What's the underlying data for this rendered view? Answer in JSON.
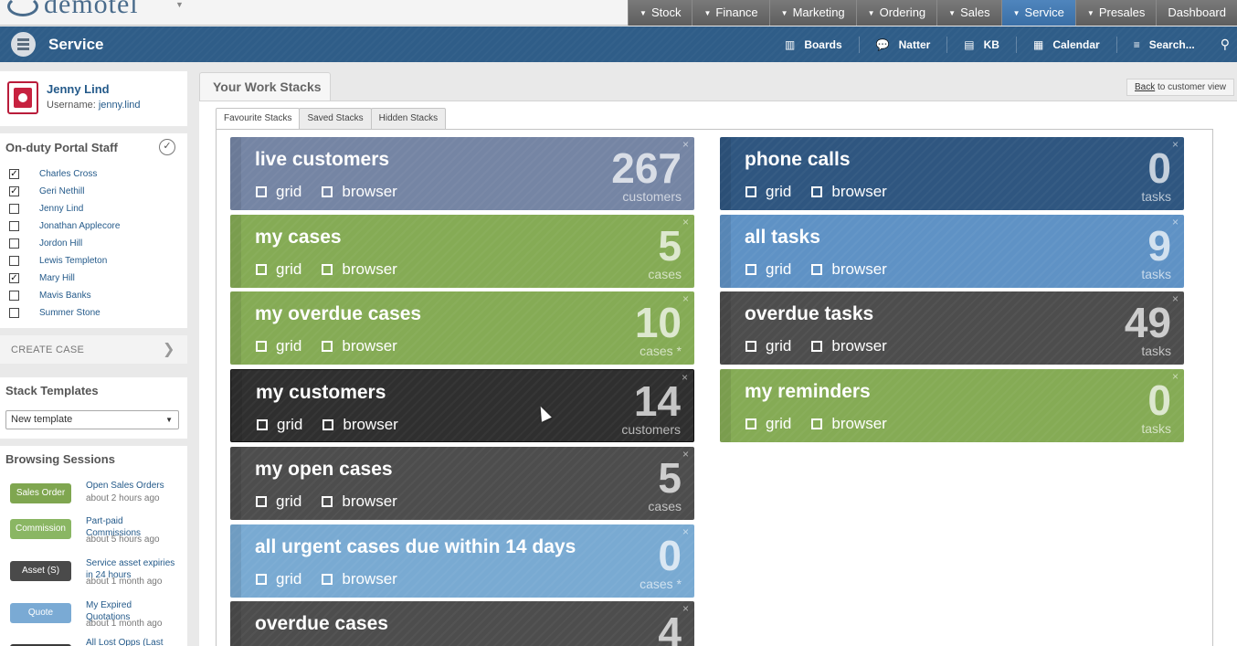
{
  "app": {
    "logo_text": "demotel"
  },
  "topnav": {
    "items": [
      {
        "label": "Stock",
        "active": false,
        "caret": true
      },
      {
        "label": "Finance",
        "active": false,
        "caret": true
      },
      {
        "label": "Marketing",
        "active": false,
        "caret": true
      },
      {
        "label": "Ordering",
        "active": false,
        "caret": true
      },
      {
        "label": "Sales",
        "active": false,
        "caret": true
      },
      {
        "label": "Service",
        "active": true,
        "caret": true
      },
      {
        "label": "Presales",
        "active": false,
        "caret": true
      },
      {
        "label": "Dashboard",
        "active": false,
        "caret": false
      }
    ]
  },
  "servicebar": {
    "title": "Service",
    "items": [
      {
        "label": "Boards",
        "icon": "boards-icon"
      },
      {
        "label": "Natter",
        "icon": "chat-icon"
      },
      {
        "label": "KB",
        "icon": "document-icon"
      },
      {
        "label": "Calendar",
        "icon": "calendar-icon"
      },
      {
        "label": "Search...",
        "icon": "menu-icon"
      }
    ]
  },
  "user": {
    "name": "Jenny Lind",
    "username_label": "Username:",
    "username": "jenny.lind"
  },
  "staff": {
    "heading": "On-duty Portal Staff",
    "members": [
      {
        "name": "Charles Cross",
        "checked": true
      },
      {
        "name": "Geri Nethill",
        "checked": true
      },
      {
        "name": "Jenny Lind",
        "checked": false
      },
      {
        "name": "Jonathan Applecore",
        "checked": false
      },
      {
        "name": "Jordon Hill",
        "checked": false
      },
      {
        "name": "Lewis Templeton",
        "checked": false
      },
      {
        "name": "Mary Hill",
        "checked": true
      },
      {
        "name": "Mavis Banks",
        "checked": false
      },
      {
        "name": "Summer Stone",
        "checked": false
      }
    ]
  },
  "create_case": {
    "label": "CREATE CASE"
  },
  "stack_templates": {
    "heading": "Stack Templates",
    "selected": "New template"
  },
  "browsing_sessions": {
    "heading": "Browsing Sessions",
    "sessions": [
      {
        "badge": "Sales Order",
        "badge_color": "#7fa650",
        "title": "Open Sales Orders",
        "time": "about 2 hours ago"
      },
      {
        "badge": "Commission",
        "badge_color": "#8ab663",
        "title": "Part-paid Commissions",
        "time": "about 5 hours ago"
      },
      {
        "badge": "Asset (S)",
        "badge_color": "#4a4a4a",
        "title": "Service asset expiries in 24 hours",
        "time": "about 1 month ago"
      },
      {
        "badge": "Quote",
        "badge_color": "#7aaad4",
        "title": "My Expired Quotations",
        "time": "about 1 month ago"
      },
      {
        "badge": "",
        "badge_color": "#3a3a3a",
        "title": "All Lost Opps (Last",
        "time": ""
      }
    ]
  },
  "main": {
    "title": "Your Work Stacks",
    "back_link": "Back",
    "back_text": "to customer view",
    "tabs": [
      {
        "label": "Favourite Stacks",
        "active": true
      },
      {
        "label": "Saved Stacks",
        "active": false
      },
      {
        "label": "Hidden Stacks",
        "active": false
      }
    ],
    "option_grid": "grid",
    "option_browser": "browser",
    "close_glyph": "×"
  },
  "stacks_left": [
    {
      "title": "live customers",
      "count": "267",
      "unit": "customers",
      "color": "#7585a4"
    },
    {
      "title": "my cases",
      "count": "5",
      "unit": "cases",
      "color": "#85ab55"
    },
    {
      "title": "my overdue cases",
      "count": "10",
      "unit": "cases *",
      "color": "#85ab55"
    },
    {
      "title": "my customers",
      "count": "14",
      "unit": "customers",
      "color": "#2f2f2f"
    },
    {
      "title": "my open cases",
      "count": "5",
      "unit": "cases",
      "color": "#4d4d4d"
    },
    {
      "title": "all urgent cases due within 14 days",
      "count": "0",
      "unit": "cases *",
      "color": "#79aad2"
    },
    {
      "title": "overdue cases",
      "count": "4",
      "unit": "",
      "color": "#4d4d4d"
    }
  ],
  "stacks_right": [
    {
      "title": "phone calls",
      "count": "0",
      "unit": "tasks",
      "color": "#2f5680"
    },
    {
      "title": "all tasks",
      "count": "9",
      "unit": "tasks",
      "color": "#5f92c5"
    },
    {
      "title": "overdue tasks",
      "count": "49",
      "unit": "tasks",
      "color": "#4d4d4d"
    },
    {
      "title": "my reminders",
      "count": "0",
      "unit": "tasks",
      "color": "#85ab55"
    }
  ]
}
